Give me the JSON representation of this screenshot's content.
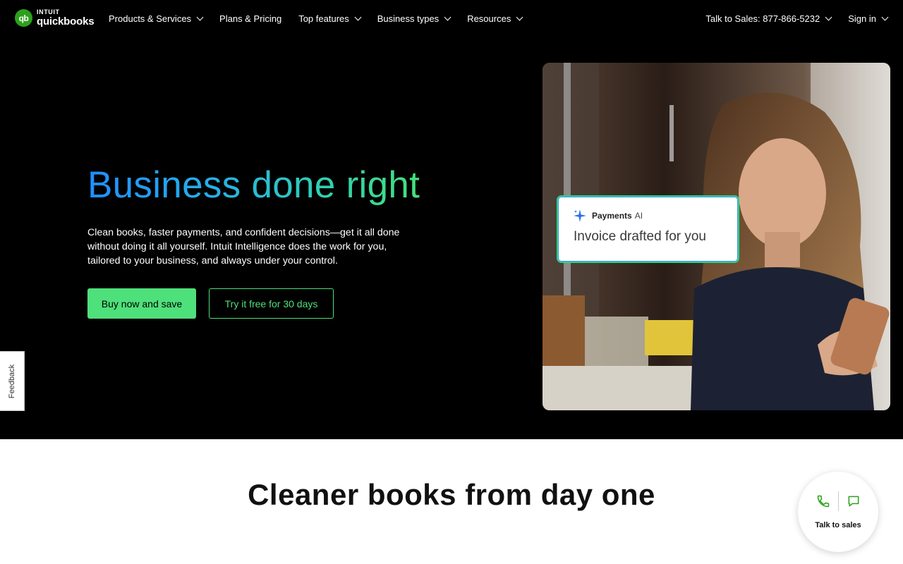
{
  "brand": {
    "intuit": "INTUIT",
    "product": "quickbooks",
    "mark": "qb",
    "green": "#2ca01c"
  },
  "nav": {
    "items": [
      {
        "label": "Products & Services",
        "has_dropdown": true
      },
      {
        "label": "Plans & Pricing",
        "has_dropdown": false
      },
      {
        "label": "Top features",
        "has_dropdown": true
      },
      {
        "label": "Business types",
        "has_dropdown": true
      },
      {
        "label": "Resources",
        "has_dropdown": true
      }
    ],
    "sales_phone": "Talk to Sales: 877-866-5232",
    "sign_in": "Sign in"
  },
  "hero": {
    "title": "Business done right",
    "subtitle": "Clean books, faster payments, and confident decisions—get it all done without doing it all yourself. Intuit Intelligence does the work for you, tailored to your business, and always under your control.",
    "primary_cta": "Buy now and save",
    "secondary_cta": "Try it free for 30 days",
    "accent": "#4ee07a"
  },
  "ai_card": {
    "product": "Payments",
    "product_suffix": "AI",
    "message": "Invoice drafted for you",
    "icon": "sparkle-icon"
  },
  "feedback": {
    "label": "Feedback"
  },
  "section": {
    "title": "Cleaner books from day one"
  },
  "sales_widget": {
    "label": "Talk to sales",
    "icons": [
      "phone-icon",
      "chat-icon"
    ],
    "accent": "#2ca01c"
  }
}
